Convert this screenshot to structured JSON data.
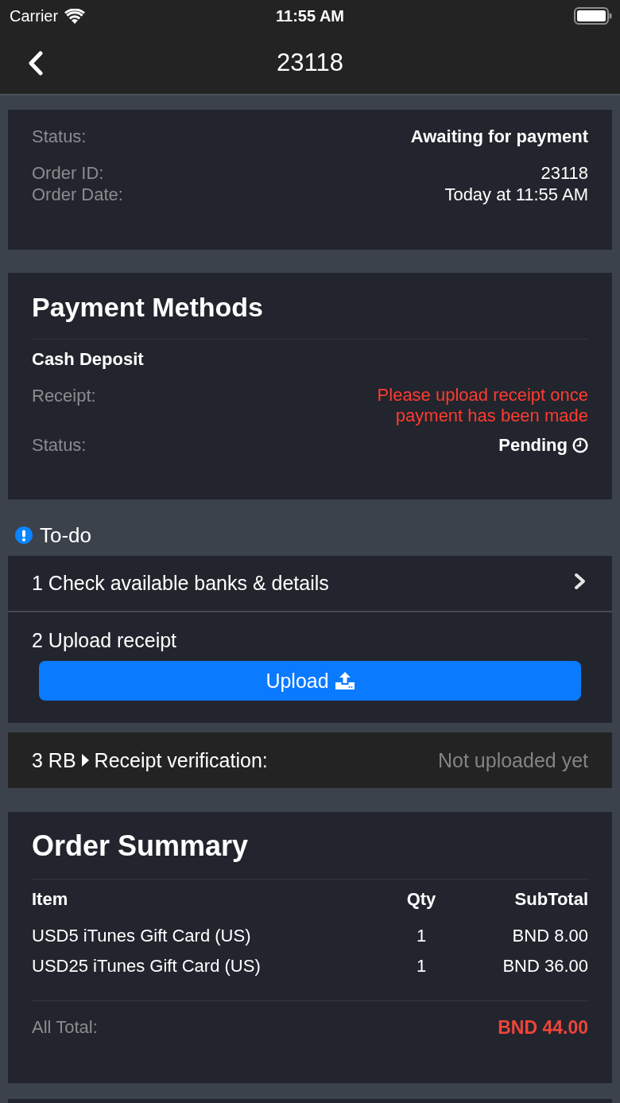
{
  "status_bar": {
    "carrier": "Carrier",
    "time": "11:55 AM"
  },
  "nav_bar": {
    "title": "23118"
  },
  "order_info": {
    "groups": [
      [
        {
          "label": "Status:",
          "value": "Awaiting for payment",
          "kind": "bold"
        }
      ],
      [
        {
          "label": "Order ID:",
          "value": "23118",
          "kind": "plain"
        },
        {
          "label": "Order Date:",
          "value": "Today at 11:55 AM",
          "kind": "plain"
        }
      ]
    ]
  },
  "payment_methods": {
    "title": "Payment Methods",
    "method": "Cash Deposit",
    "rows": [
      {
        "label": "Receipt:",
        "value": "Please upload receipt once payment has been made",
        "kind": "warning"
      },
      {
        "label": "Status:",
        "value": "Pending",
        "kind": "status"
      }
    ]
  },
  "todo": {
    "title": "To-do",
    "steps": [
      {
        "kind": "link",
        "label": "1 Check available banks & details"
      },
      {
        "kind": "upload",
        "label": "2 Upload receipt",
        "button": "Upload"
      },
      {
        "kind": "verification",
        "prefix": "3 RB",
        "label": "Receipt verification:",
        "value": "Not uploaded yet"
      }
    ]
  },
  "order_summary": {
    "title": "Order Summary",
    "columns": [
      "Item",
      "Qty",
      "SubTotal"
    ],
    "rows": [
      [
        "USD5 iTunes Gift Card (US)",
        "1",
        "BND 8.00"
      ],
      [
        "USD25 iTunes Gift Card (US)",
        "1",
        "BND 36.00"
      ]
    ],
    "total_label": "All Total:",
    "total_value": "BND 44.00"
  }
}
